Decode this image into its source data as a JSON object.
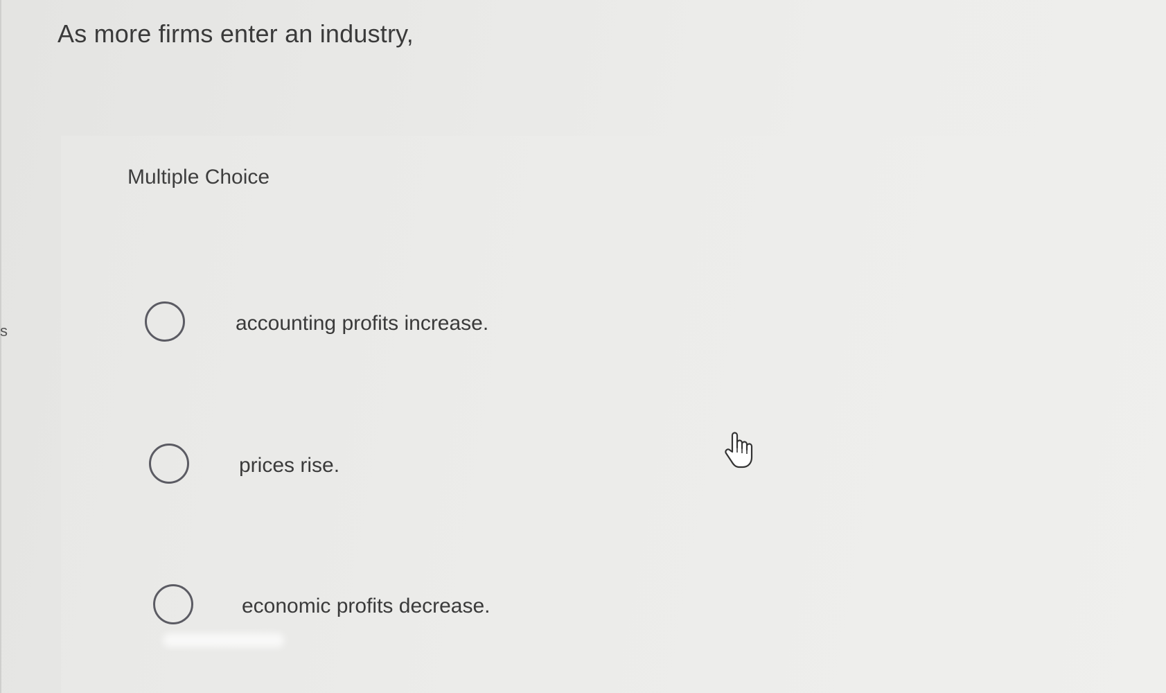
{
  "side_marker": "s",
  "question": {
    "text": "As more firms enter an industry,"
  },
  "answer_section": {
    "label": "Multiple Choice",
    "options": [
      {
        "text": "accounting profits increase.",
        "selected": false
      },
      {
        "text": "prices rise.",
        "selected": false
      },
      {
        "text": "economic profits decrease.",
        "selected": false
      }
    ]
  },
  "cursor": {
    "icon": "hand-pointer-icon"
  }
}
